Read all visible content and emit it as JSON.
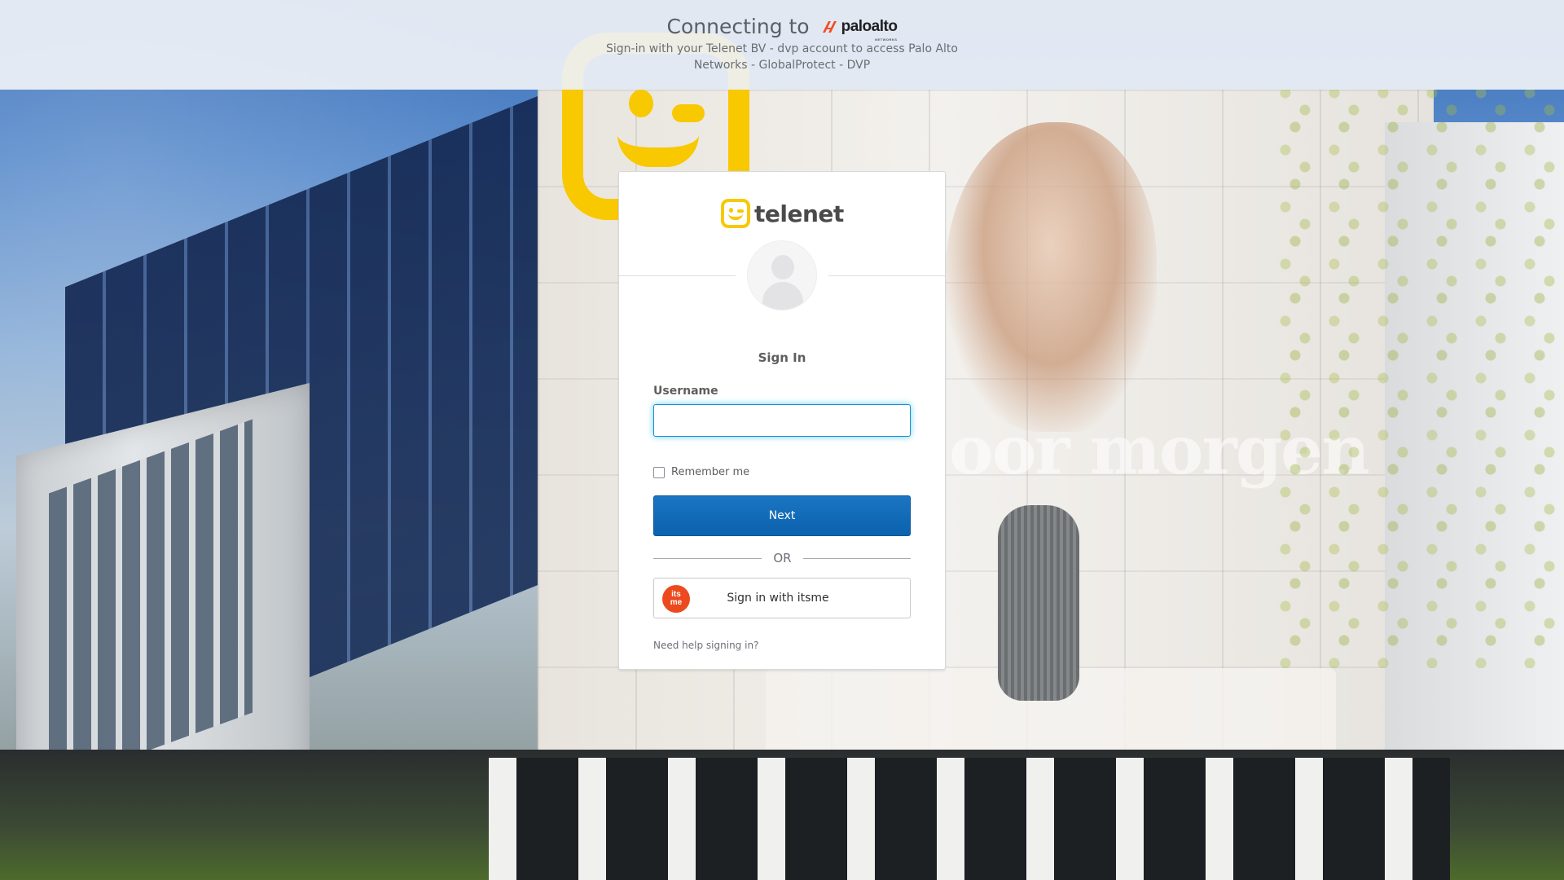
{
  "banner": {
    "connecting_text": "Connecting to",
    "logo_word": "paloalto",
    "logo_sub": "NETWORKS",
    "description": "Sign-in with your Telenet BV - dvp account to access Palo Alto Networks - GlobalProtect - DVP"
  },
  "background": {
    "tagline": "oor morgen"
  },
  "card": {
    "logo_word": "telenet",
    "title": "Sign In",
    "username": {
      "label": "Username",
      "value": "",
      "placeholder": ""
    },
    "remember_label": "Remember me",
    "remember_checked": false,
    "next_label": "Next",
    "or_label": "OR",
    "itsme": {
      "icon_text_top": "its",
      "icon_text_bottom": "me",
      "label": "Sign in with itsme"
    },
    "help_link": "Need help signing in?"
  },
  "colors": {
    "primary_button": "#0b62ae",
    "input_focus": "#1f8ccc",
    "telenet_yellow": "#f8c800",
    "itsme_orange": "#ec4a1e"
  },
  "icons": {
    "avatar": "user-avatar-placeholder-icon",
    "itsme": "itsme-logo-icon",
    "telenet": "telenet-logo-icon",
    "paloalto": "paloalto-logo-icon"
  }
}
